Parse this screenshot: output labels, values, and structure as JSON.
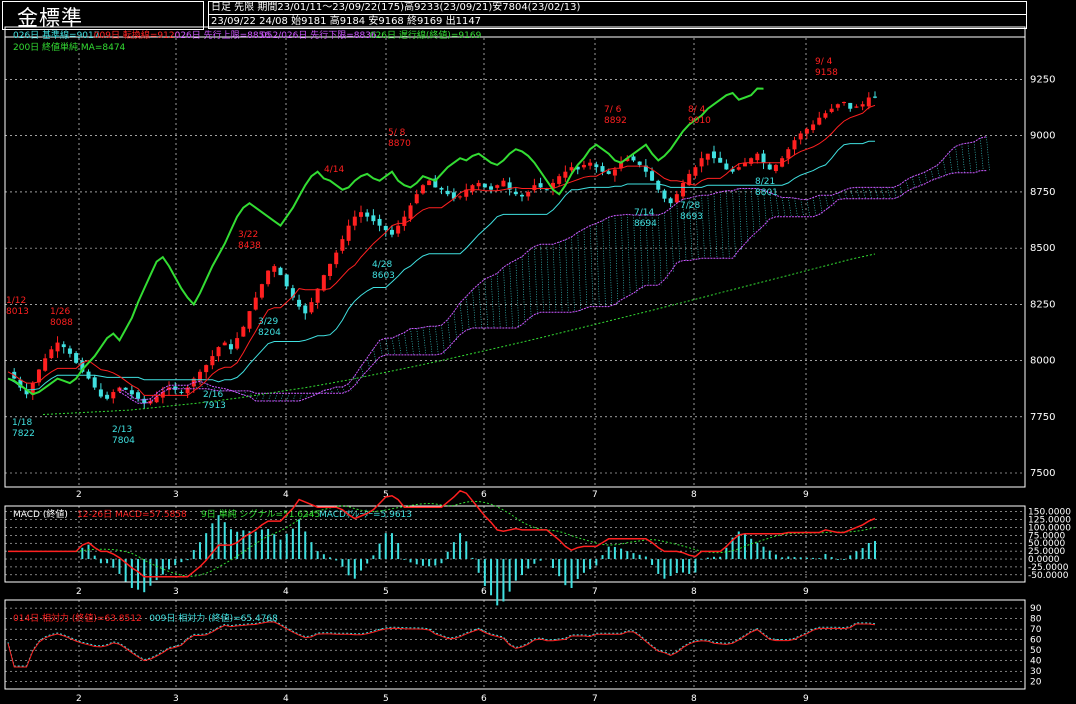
{
  "header": {
    "title": "金標準",
    "info_line1": "日足  先限  期間23/01/11～23/09/22(175)高9233(23/09/21)安7804(23/02/13)",
    "info_line2": "23/09/22 24/08 始9181 高9184 安9168 終9169 出1147"
  },
  "colors": {
    "bg": "#000000",
    "up": "#ff2020",
    "down": "#40e0e0",
    "green": "#33dd33",
    "magenta": "#cc55ff",
    "cyan": "#40e0e0",
    "red": "#ff2020",
    "grid": "#ffffff"
  },
  "legends": {
    "main": [
      {
        "text": "026日 基準線=9017",
        "color": "#40e0e0"
      },
      {
        "text": "009日 転換線=9120",
        "color": "#ff2020"
      },
      {
        "text": "026日 先行上限=8856",
        "color": "#cc55ff"
      },
      {
        "text": "052/026日 先行下限=8836",
        "color": "#cc55ff"
      },
      {
        "text": "026日 遅行線(終値)=9169",
        "color": "#33dd33"
      }
    ],
    "main2": [
      {
        "text": "200日 終値単純 MA=8474",
        "color": "#33dd33"
      }
    ],
    "macd": [
      {
        "text": "MACD (終値)",
        "color": "#ffffff"
      },
      {
        "text": "12-26日 MACD=57.5858",
        "color": "#ff2020"
      },
      {
        "text": "9日 単純 シグナル=51.6245",
        "color": "#33dd33"
      },
      {
        "text": "MACDｵｼﾚｰﾀｰ=5.9613",
        "color": "#40e0e0"
      }
    ],
    "rsi": [
      {
        "text": "014日 相対力 (終値)=63.8512",
        "color": "#ff2020"
      },
      {
        "text": "009日 相対力 (終値)=65.4768",
        "color": "#40e0e0"
      }
    ]
  },
  "chart_data": [
    {
      "type": "candlestick",
      "title": "金標準",
      "x_ticks": [
        "2",
        "3",
        "4",
        "5",
        "6",
        "7",
        "8",
        "9"
      ],
      "y_ticks": [
        "9250",
        "9000",
        "8750",
        "8500",
        "8250",
        "8000",
        "7750",
        "7500"
      ],
      "ylim": [
        7500,
        9350
      ],
      "annotations": [
        {
          "date": "1/12",
          "value": "8013",
          "color": "#ff2020"
        },
        {
          "date": "1/26",
          "value": "8088",
          "color": "#ff2020"
        },
        {
          "date": "1/18",
          "value": "7822",
          "color": "#40e0e0"
        },
        {
          "date": "2/13",
          "value": "7804",
          "color": "#40e0e0"
        },
        {
          "date": "2/16",
          "value": "7913",
          "color": "#40e0e0"
        },
        {
          "date": "3/22",
          "value": "8438",
          "color": "#ff2020"
        },
        {
          "date": "3/29",
          "value": "8204",
          "color": "#40e0e0"
        },
        {
          "date": "4/14",
          "value": "",
          "color": "#ff2020"
        },
        {
          "date": "4/28",
          "value": "8603",
          "color": "#40e0e0"
        },
        {
          "date": "5/ 8",
          "value": "8870",
          "color": "#ff2020"
        },
        {
          "date": "7/ 6",
          "value": "8892",
          "color": "#ff2020"
        },
        {
          "date": "7/14",
          "value": "8694",
          "color": "#40e0e0"
        },
        {
          "date": "7/28",
          "value": "8693",
          "color": "#40e0e0"
        },
        {
          "date": "8/ 4",
          "value": "9010",
          "color": "#ff2020"
        },
        {
          "date": "8/21",
          "value": "8801",
          "color": "#40e0e0"
        },
        {
          "date": "9/ 4",
          "value": "9158",
          "color": "#ff2020"
        }
      ],
      "close": [
        7950,
        7920,
        7880,
        7850,
        7900,
        7960,
        8010,
        8050,
        8080,
        8060,
        8030,
        7990,
        7950,
        7920,
        7880,
        7840,
        7830,
        7860,
        7880,
        7870,
        7850,
        7830,
        7810,
        7820,
        7840,
        7860,
        7880,
        7870,
        7860,
        7880,
        7920,
        7950,
        7980,
        8020,
        8060,
        8080,
        8050,
        8100,
        8150,
        8220,
        8280,
        8340,
        8400,
        8420,
        8380,
        8330,
        8280,
        8240,
        8210,
        8260,
        8320,
        8380,
        8430,
        8480,
        8540,
        8600,
        8640,
        8660,
        8640,
        8620,
        8600,
        8580,
        8560,
        8600,
        8640,
        8690,
        8740,
        8780,
        8800,
        8770,
        8760,
        8740,
        8720,
        8730,
        8760,
        8780,
        8790,
        8770,
        8760,
        8780,
        8800,
        8760,
        8740,
        8730,
        8750,
        8780,
        8770,
        8760,
        8790,
        8820,
        8840,
        8860,
        8850,
        8870,
        8880,
        8860,
        8840,
        8830,
        8850,
        8880,
        8900,
        8890,
        8870,
        8840,
        8800,
        8760,
        8720,
        8700,
        8740,
        8790,
        8830,
        8860,
        8900,
        8920,
        8900,
        8880,
        8850,
        8840,
        8860,
        8880,
        8900,
        8920,
        8880,
        8850,
        8870,
        8900,
        8940,
        8980,
        9010,
        9030,
        9050,
        9080,
        9100,
        9120,
        9140,
        9150,
        9120,
        9130,
        9140,
        9170,
        9169
      ],
      "ma200": [
        7760,
        7765,
        7770,
        7775,
        7780,
        7790,
        7800,
        7810,
        7822,
        7835,
        7850,
        7865,
        7880,
        7897,
        7915,
        7935,
        7955,
        7975,
        7996,
        8018,
        8040,
        8062,
        8085,
        8108,
        8132,
        8156,
        8180,
        8204,
        8228,
        8253,
        8278,
        8303,
        8328,
        8353,
        8378,
        8403,
        8428,
        8453,
        8474
      ],
      "macd": {
        "macd": 57.5858,
        "signal": 51.6245,
        "oscillator": 5.9613,
        "y_ticks": [
          "150",
          "125",
          "100",
          "75",
          "50",
          "25",
          "0",
          "-25",
          "-50"
        ]
      },
      "rsi": {
        "rsi14": 63.8512,
        "rsi9": 65.4768,
        "y_ticks": [
          "90",
          "80",
          "70",
          "60",
          "50",
          "40",
          "30",
          "20"
        ]
      }
    }
  ]
}
